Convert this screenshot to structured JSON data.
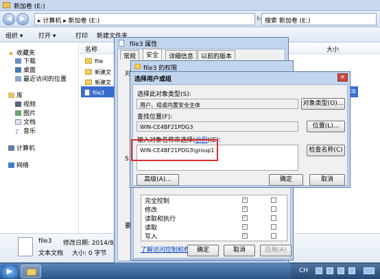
{
  "explorer": {
    "title": "新加卷 (E:)",
    "address": "▸ 计算机 ▸ 新加卷 (E:)",
    "search_placeholder": "搜索 新加卷 (E:)",
    "toolbar": [
      "组织 ▾",
      "打开 ▾",
      "打印",
      "新建文件夹"
    ],
    "nav": {
      "favorites": "收藏夹",
      "favorites_items": [
        "下载",
        "桌面",
        "最近访问的位置"
      ],
      "libraries": "库",
      "libraries_items": [
        "视频",
        "图片",
        "文档",
        "音乐"
      ],
      "computer": "计算机",
      "network": "网络"
    },
    "columns": {
      "name": "名称",
      "size": "大小"
    },
    "files": [
      "file",
      "新建文",
      "新建文",
      "file3"
    ],
    "size_fragment": "KB",
    "details": {
      "name": "file3",
      "modified": "修改日期: 2014/8/1",
      "type": "文本文档",
      "size": "大小: 0 字节"
    }
  },
  "taskbar": {
    "tray": {
      "lang": "CH"
    }
  },
  "props_dialog": {
    "title": "file3 属性",
    "tabs": [
      "常规",
      "安全",
      "详细信息",
      "以前的版本"
    ],
    "fragments": {
      "l1": "对",
      "l2": "S",
      "l3": "要"
    }
  },
  "perm_dialog": {
    "title": "file3 的权限",
    "rows": [
      "完全控制",
      "修改",
      "读取和执行",
      "读取",
      "写入"
    ],
    "allow": [
      true,
      true,
      true,
      true,
      true
    ],
    "deny": [
      false,
      false,
      false,
      false,
      false
    ],
    "link": "了解访问控制和权限",
    "buttons": {
      "ok": "确定",
      "cancel": "取消",
      "apply": "应用(A)"
    }
  },
  "select_dialog": {
    "title": "选择用户或组",
    "object_type_label": "选择此对象类型(S):",
    "object_type_value": "用户、组或内置安全主体",
    "object_type_button": "对象类型(O)...",
    "location_label": "查找位置(F):",
    "location_value": "WIN-CE4BF21PDG3",
    "location_button": "位置(L)...",
    "names_label_pre": "输入对象名称来选择(",
    "names_label_link": "示例",
    "names_label_post": ")(E):",
    "names_value": "WIN-CE4BF21PDG3\\group1",
    "check_button": "检查名称(C)",
    "advanced_button": "高级(A)...",
    "ok_button": "确定",
    "cancel_button": "取消"
  },
  "colors": {
    "highlight_box": "#d92a2a",
    "selection": "#3a6ccf"
  }
}
